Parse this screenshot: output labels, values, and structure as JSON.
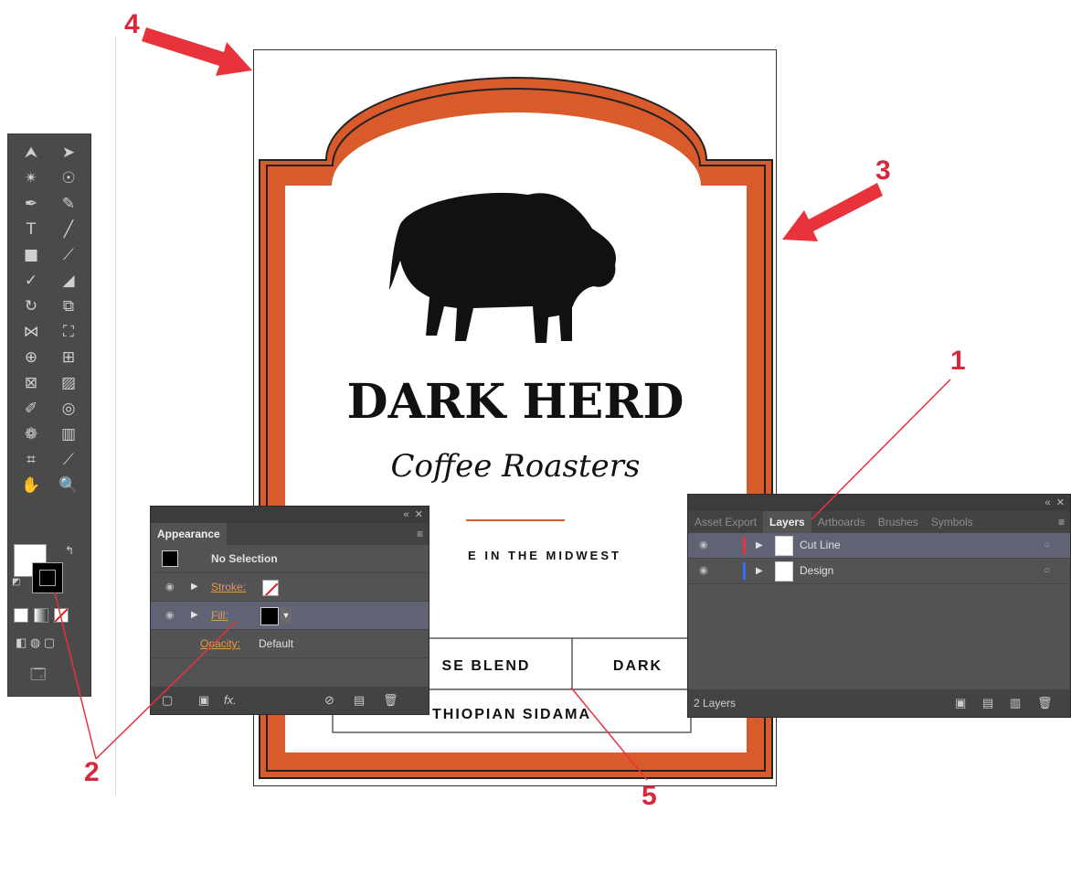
{
  "annotations": {
    "callout_1": "1",
    "callout_2": "2",
    "callout_3": "3",
    "callout_4": "4",
    "callout_5": "5",
    "accent_color": "#e8333c"
  },
  "label_design": {
    "brand": "DARK HERD",
    "sub_brand": "Coffee Roasters",
    "tagline_partial": "E IN THE MIDWEST",
    "blend_partial": "SE BLEND",
    "roast": "DARK",
    "origin_partial": "THIOPIAN SIDAMA",
    "frame_color": "#d95a2b"
  },
  "tools": [
    "selection-tool",
    "direct-selection-tool",
    "magic-wand-tool",
    "lasso-tool",
    "pen-tool",
    "curvature-tool",
    "type-tool",
    "line-tool",
    "rectangle-tool",
    "paintbrush-tool",
    "shaper-tool",
    "eraser-tool",
    "rotate-tool",
    "scale-tool",
    "width-tool",
    "free-transform-tool",
    "shape-builder-tool",
    "perspective-grid-tool",
    "mesh-tool",
    "gradient-tool",
    "eyedropper-tool",
    "blend-tool",
    "symbol-sprayer-tool",
    "column-graph-tool",
    "artboard-tool",
    "slice-tool",
    "hand-tool",
    "zoom-tool"
  ],
  "appearance_panel": {
    "title": "Appearance",
    "selection": "No Selection",
    "stroke_label": "Stroke:",
    "fill_label": "Fill:",
    "opacity_label": "Opacity:",
    "opacity_value": "Default"
  },
  "layers_panel": {
    "tabs": [
      "Asset Export",
      "Layers",
      "Artboards",
      "Brushes",
      "Symbols"
    ],
    "active_tab": "Layers",
    "layers": [
      {
        "name": "Cut Line",
        "color": "#e8333c"
      },
      {
        "name": "Design",
        "color": "#3a6bff"
      }
    ],
    "layer_count": "2 Layers"
  }
}
